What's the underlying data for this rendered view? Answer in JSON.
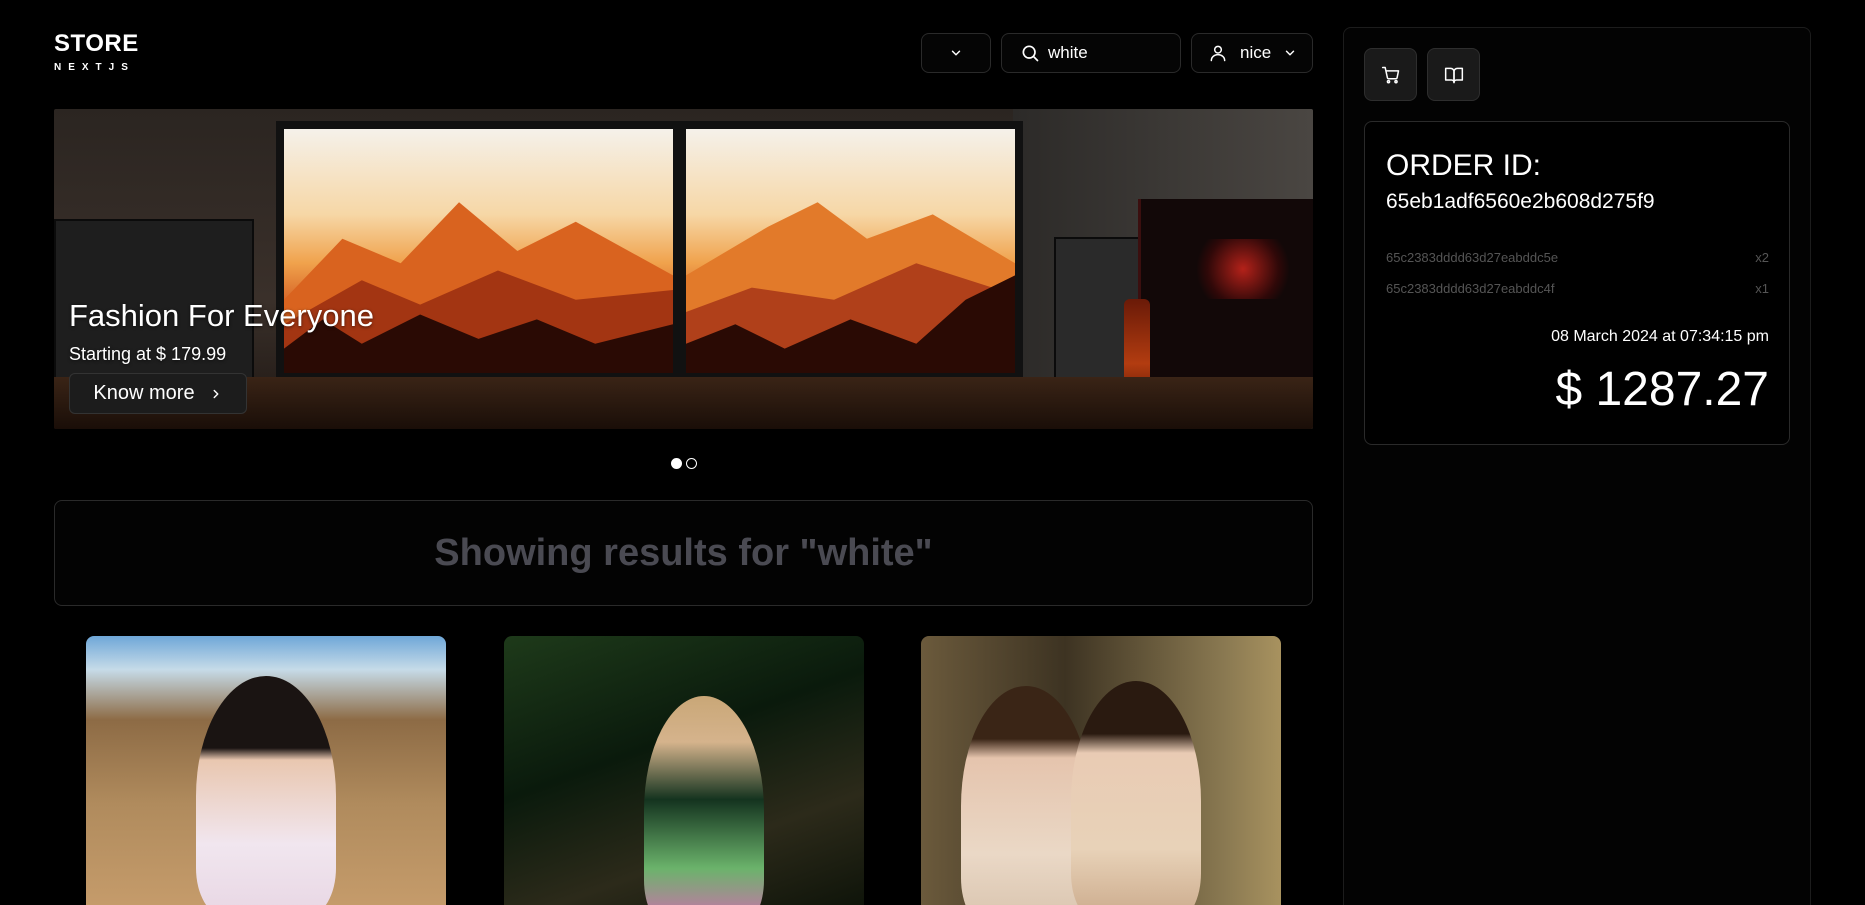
{
  "header": {
    "logo_title": "STORE",
    "logo_subtitle": "NEXTJS",
    "category_icon": "chevron-down-icon",
    "search": {
      "value": "white",
      "icon": "search-icon"
    },
    "user": {
      "name": "nice",
      "icon": "user-icon"
    }
  },
  "banner": {
    "title": "Fashion For Everyone",
    "subtitle": "Starting at $ 179.99",
    "button_label": "Know more",
    "slides_total": 2,
    "active_slide": 1
  },
  "results": {
    "text": "Showing results for \"white\""
  },
  "products": [
    {
      "id": "product-1"
    },
    {
      "id": "product-2"
    },
    {
      "id": "product-3"
    }
  ],
  "sidepanel": {
    "cart_icon": "cart-icon",
    "orders_icon": "book-open-icon",
    "order": {
      "label": "ORDER ID:",
      "id": "65eb1adf6560e2b608d275f9",
      "items": [
        {
          "product_id": "65c2383dddd63d27eabddc5e",
          "qty": "x2"
        },
        {
          "product_id": "65c2383dddd63d27eabddc4f",
          "qty": "x1"
        }
      ],
      "date": "08 March 2024 at 07:34:15 pm",
      "total": "$ 1287.27"
    }
  },
  "colors": {
    "background": "#000000",
    "border": "#2a2a2a",
    "muted_text": "#4a4a52"
  }
}
